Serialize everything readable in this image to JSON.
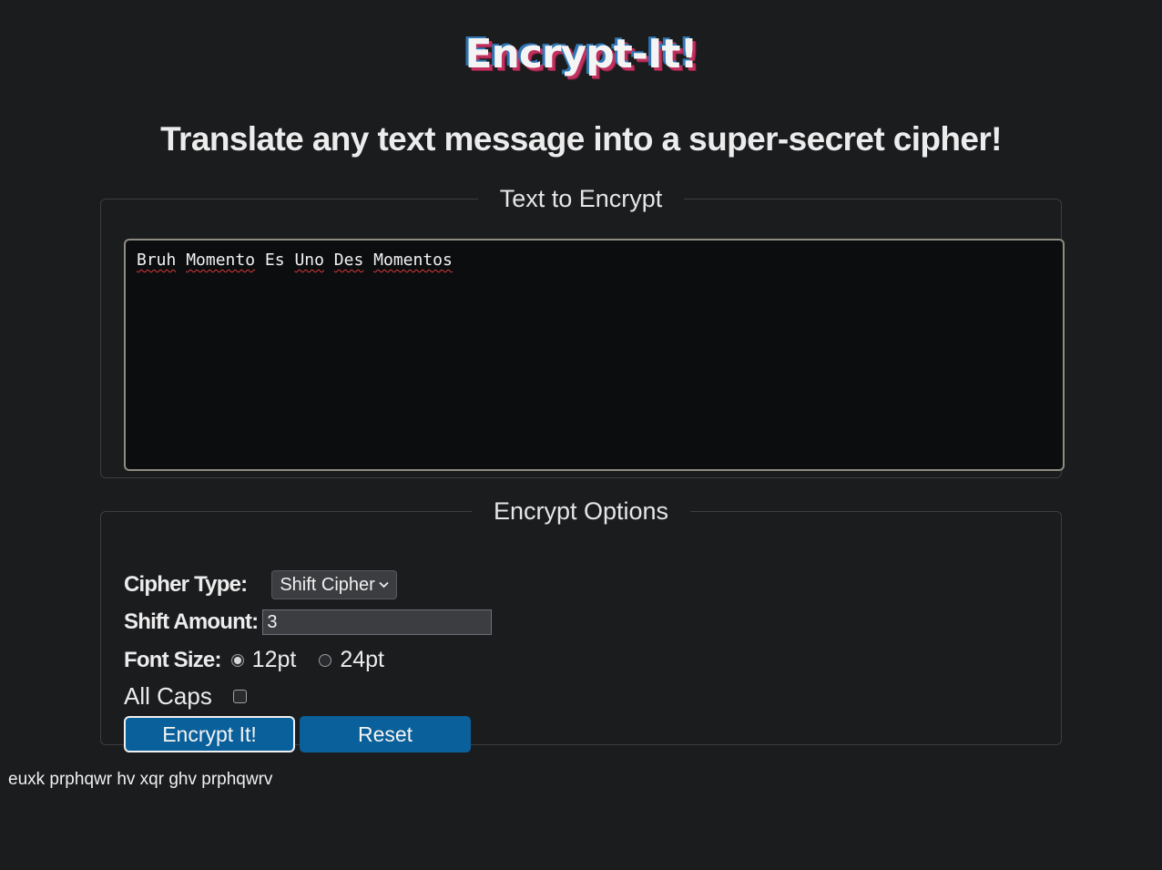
{
  "header": {
    "logo_text": "Encrypt-It!",
    "subtitle": "Translate any text message into a super-secret cipher!"
  },
  "text_section": {
    "legend": "Text to Encrypt",
    "input_words": [
      "Bruh",
      "Momento",
      "Es",
      "Uno",
      "Des",
      "Momentos"
    ]
  },
  "options": {
    "legend": "Encrypt Options",
    "cipher_type_label": "Cipher Type:",
    "cipher_type_value": "Shift Cipher",
    "shift_amount_label": "Shift Amount:",
    "shift_amount_value": "3",
    "font_size_label": "Font Size:",
    "font_size_options": [
      {
        "label": "12pt",
        "selected": true
      },
      {
        "label": "24pt",
        "selected": false
      }
    ],
    "all_caps_label": "All Caps",
    "all_caps_checked": false,
    "encrypt_button": "Encrypt It!",
    "reset_button": "Reset"
  },
  "output": {
    "text": "euxk prphqwr hv xqr ghv prphqwrv"
  },
  "colors": {
    "background": "#1b1c1e",
    "button_blue": "#0a609a",
    "logo_blue": "#2f77b5",
    "logo_red": "#c0315f"
  }
}
